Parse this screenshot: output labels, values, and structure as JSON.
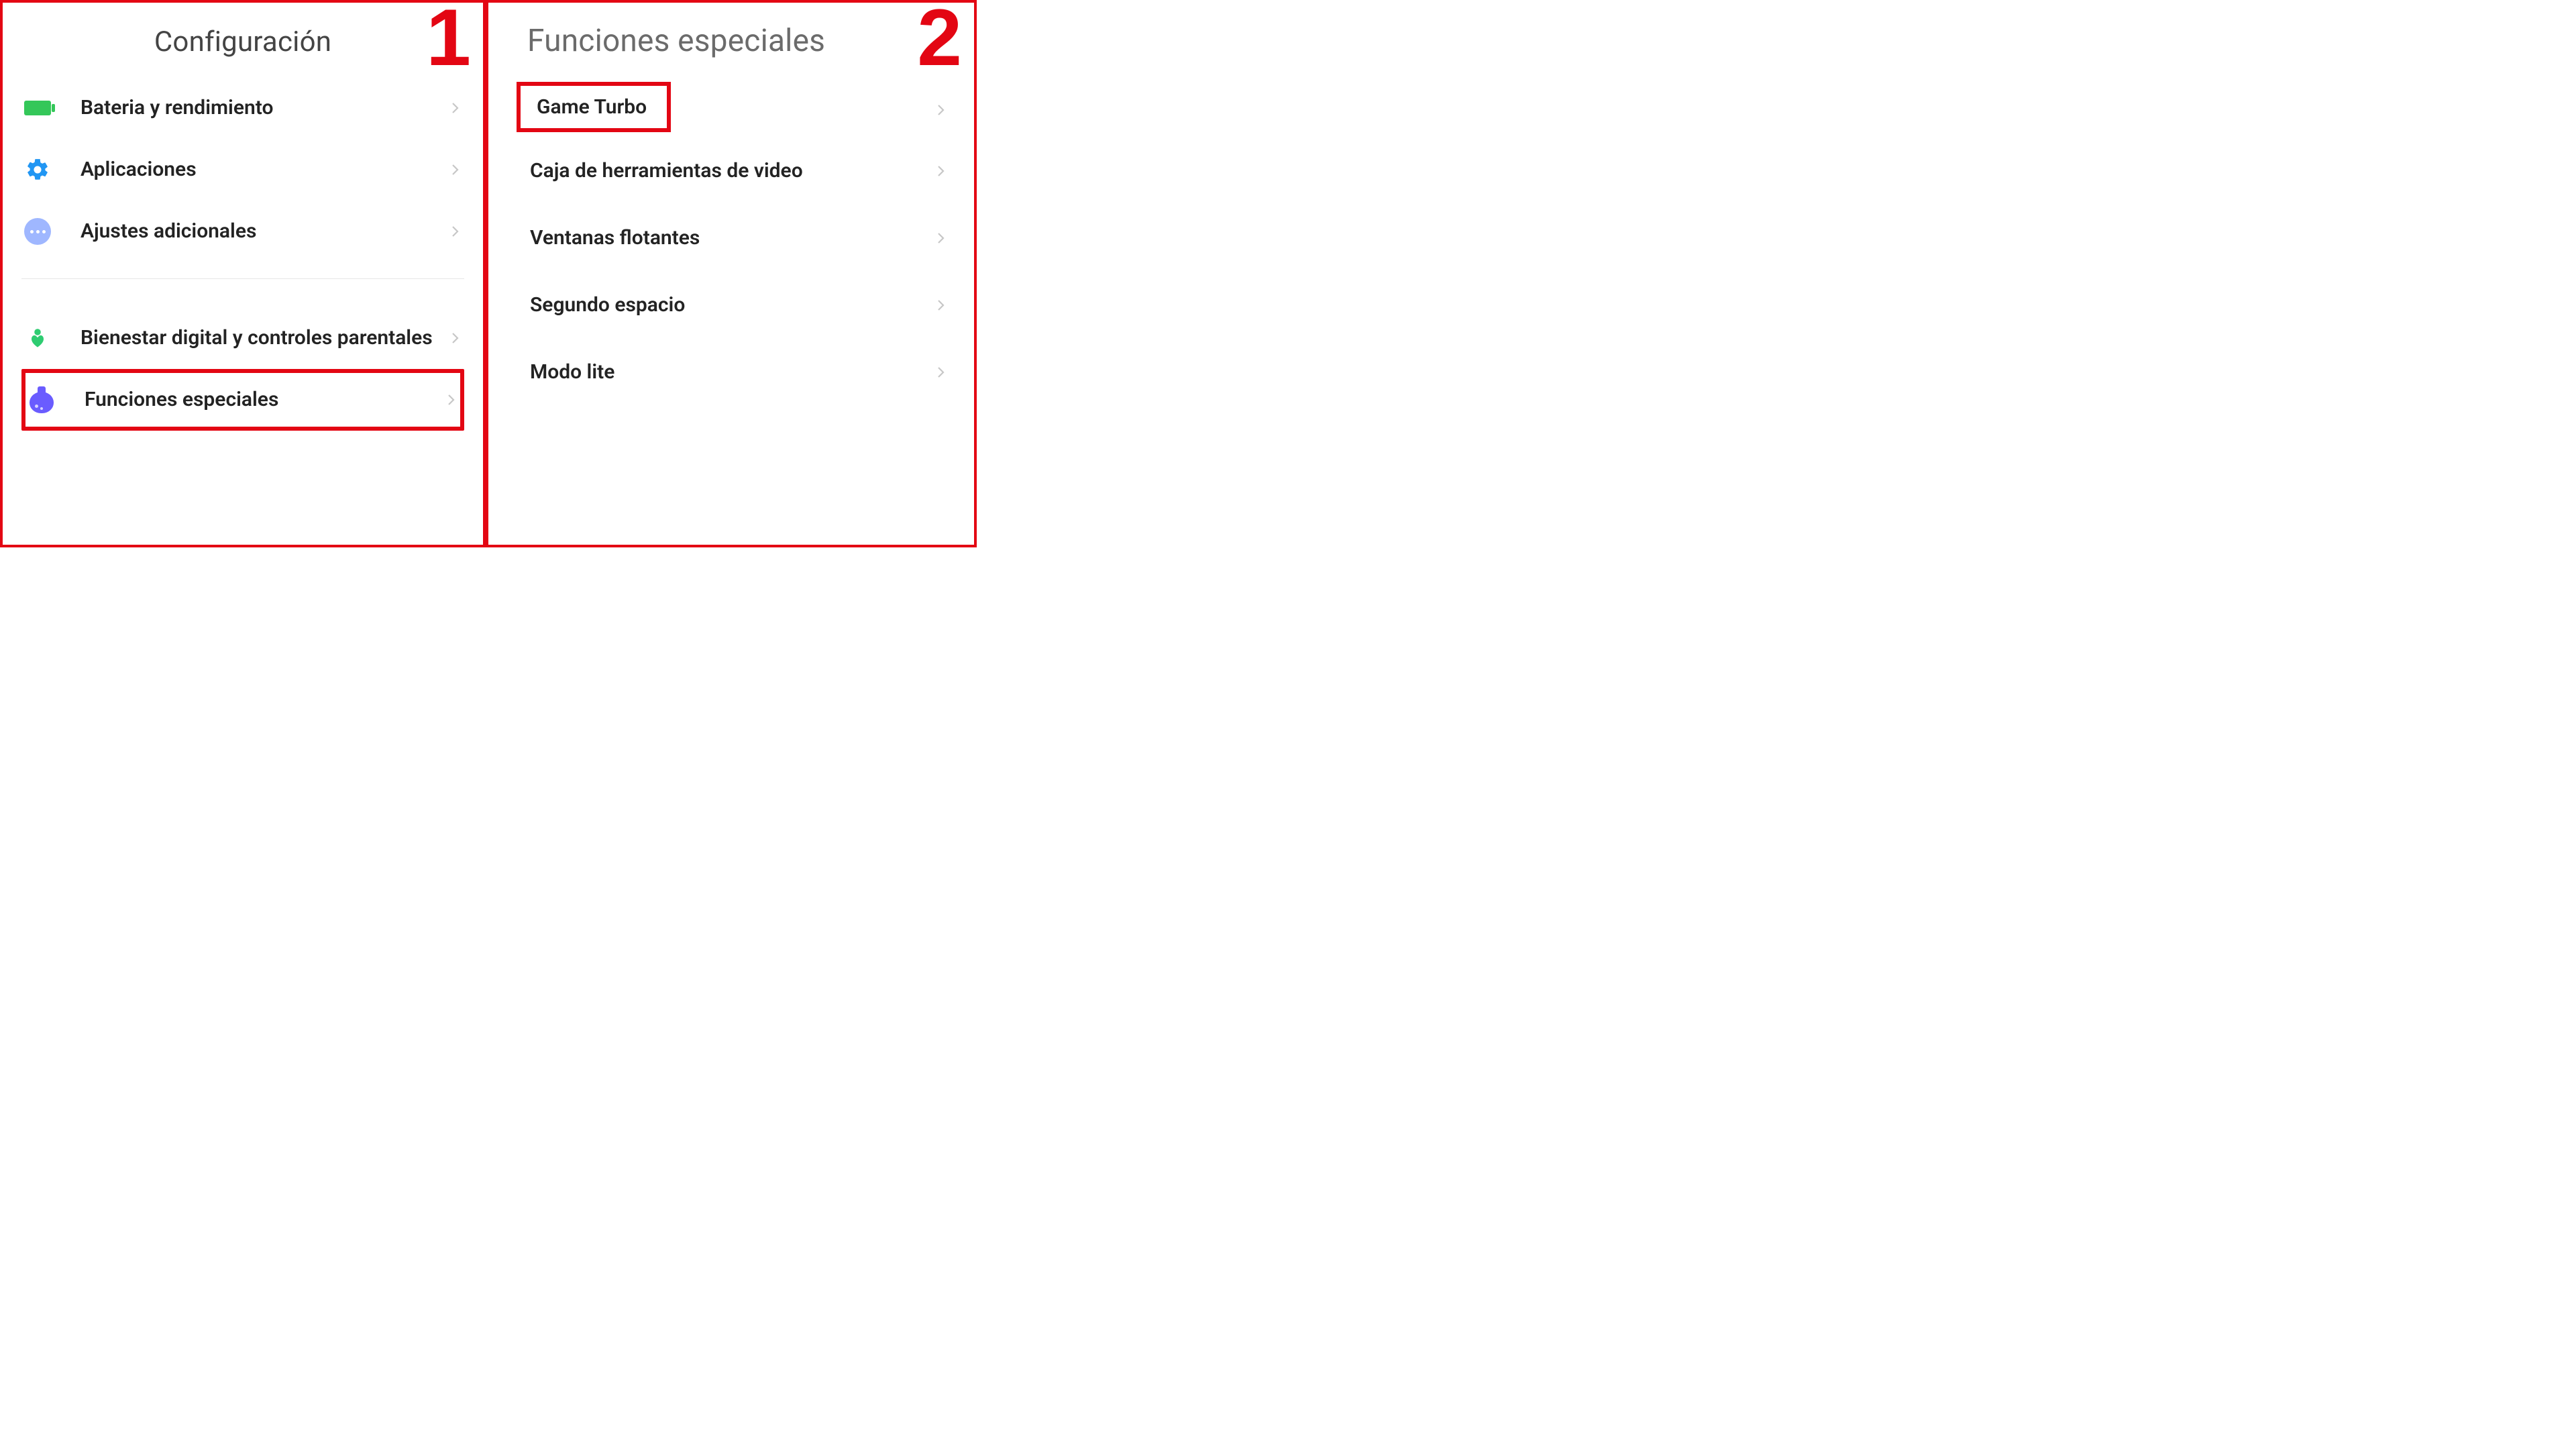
{
  "panel1": {
    "step": "1",
    "title": "Configuración",
    "items": [
      {
        "id": "battery",
        "label": "Bateria y rendimiento",
        "icon": "battery-icon"
      },
      {
        "id": "apps",
        "label": "Aplicaciones",
        "icon": "gear-icon"
      },
      {
        "id": "additional",
        "label": "Ajustes adicionales",
        "icon": "dots-icon"
      }
    ],
    "items_after_divider": [
      {
        "id": "wellbeing",
        "label": "Bienestar digital y controles parentales",
        "icon": "wellbeing-icon"
      },
      {
        "id": "special",
        "label": "Funciones especiales",
        "icon": "special-features-icon",
        "highlighted": true
      }
    ]
  },
  "panel2": {
    "step": "2",
    "title": "Funciones especiales",
    "items": [
      {
        "id": "game-turbo",
        "label": "Game Turbo",
        "highlighted": true
      },
      {
        "id": "video-tools",
        "label": "Caja de herramientas de video"
      },
      {
        "id": "floating",
        "label": "Ventanas flotantes"
      },
      {
        "id": "second-space",
        "label": "Segundo espacio"
      },
      {
        "id": "lite-mode",
        "label": "Modo lite"
      }
    ]
  }
}
